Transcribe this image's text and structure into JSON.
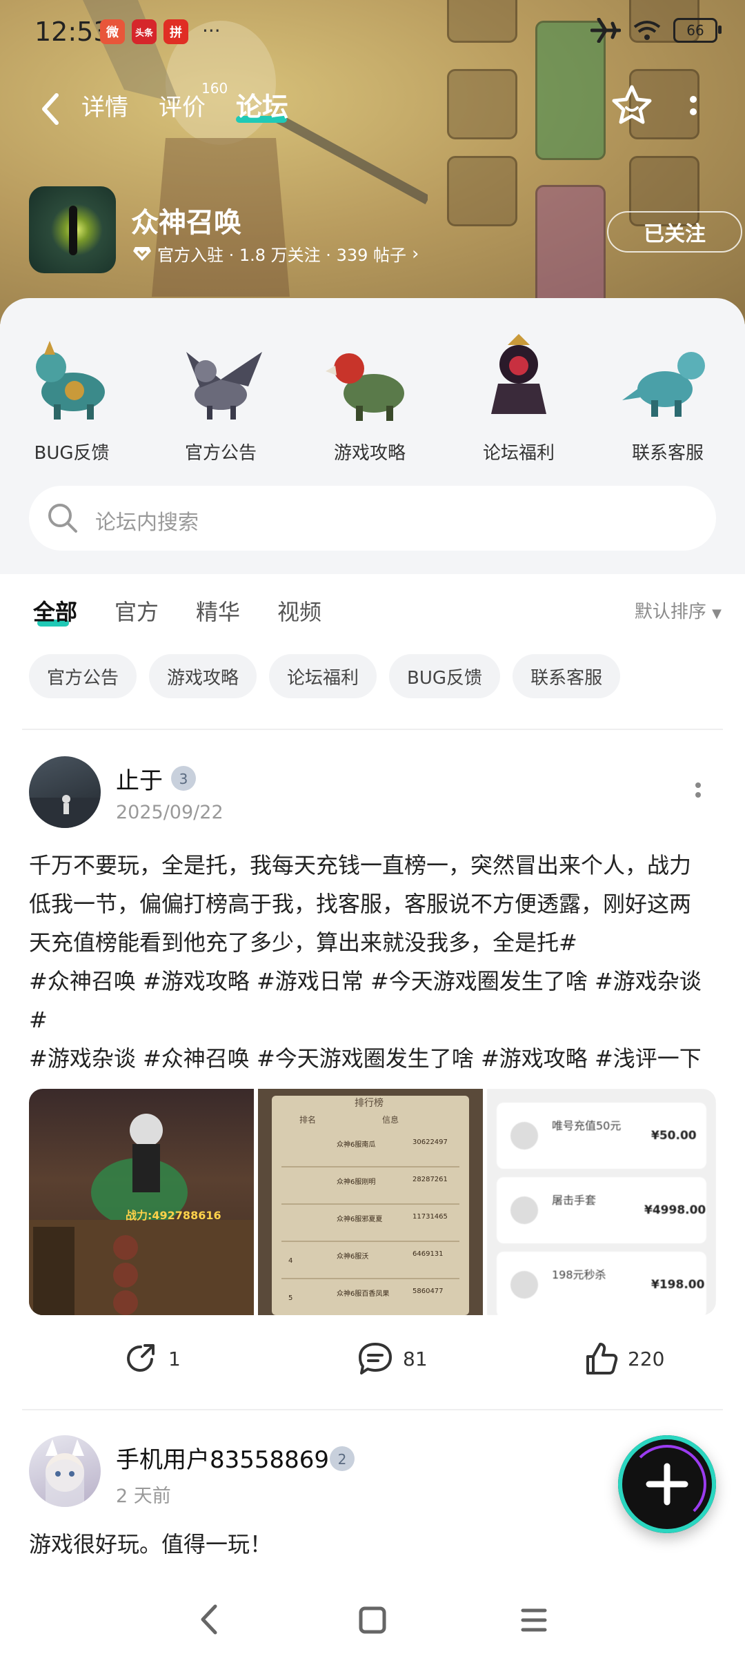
{
  "status_bar": {
    "time": "12:53",
    "app_badges": [
      "微",
      "头条",
      "拼"
    ],
    "battery": "66"
  },
  "nav": {
    "tabs": [
      "详情",
      "评价",
      "论坛"
    ],
    "active_tab": "论坛",
    "review_count": "160"
  },
  "app": {
    "name": "众神召唤",
    "meta": "官方入驻 · 1.8 万关注 · 339 帖子",
    "follow_label": "已关注"
  },
  "categories": [
    {
      "label": "BUG反馈"
    },
    {
      "label": "官方公告"
    },
    {
      "label": "游戏攻略"
    },
    {
      "label": "论坛福利"
    },
    {
      "label": "联系客服"
    }
  ],
  "search": {
    "placeholder": "论坛内搜索"
  },
  "feed_tabs": [
    "全部",
    "官方",
    "精华",
    "视频"
  ],
  "sort_label": "默认排序",
  "chips": [
    "官方公告",
    "游戏攻略",
    "论坛福利",
    "BUG反馈",
    "联系客服"
  ],
  "posts": [
    {
      "user": "止于",
      "level": "3",
      "date": "2025/09/22",
      "text_lines": [
        "千万不要玩，全是托，我每天充钱一直榜一，突然冒出来个人，战力",
        "低我一节，偏偏打榜高于我，找客服，客服说不方便透露，刚好这两",
        "天充值榜能看到他充了多少，算出来就没我多，全是托#",
        "#众神召唤 #游戏攻略 #游戏日常 #今天游戏圈发生了啥 #游戏杂谈",
        "#",
        "#游戏杂谈 #众神召唤 #今天游戏圈发生了啥 #游戏攻略 #浅评一下"
      ],
      "image1": {
        "power": "战力:492788616"
      },
      "image2": {
        "title": "排行榜",
        "headers": [
          "排名",
          "信息"
        ],
        "rows": [
          {
            "name": "众神6服南瓜",
            "value": "30622497"
          },
          {
            "name": "众神6服刚明",
            "value": "28287261"
          },
          {
            "name": "众神6服邪夏夏",
            "value": "11731465"
          },
          {
            "name": "众神6服沃",
            "value": "6469131",
            "rank": "4"
          },
          {
            "name": "众神6服百香凤果",
            "value": "5860477",
            "rank": "5"
          }
        ]
      },
      "image3": {
        "rows": [
          {
            "title": "唯号充值50元",
            "amount": "¥50.00"
          },
          {
            "title": "屠击手套",
            "amount": "¥4998.00"
          },
          {
            "title": "198元秒杀",
            "amount": "¥198.00"
          }
        ]
      },
      "shares": "1",
      "comments": "81",
      "likes": "220"
    },
    {
      "user": "手机用户83558869",
      "level": "2",
      "date": "2 天前",
      "text_lines": [
        "游戏很好玩。值得一玩！"
      ]
    }
  ],
  "colors": {
    "accent": "#20c9b6",
    "header_gold": "#b89b5e"
  }
}
